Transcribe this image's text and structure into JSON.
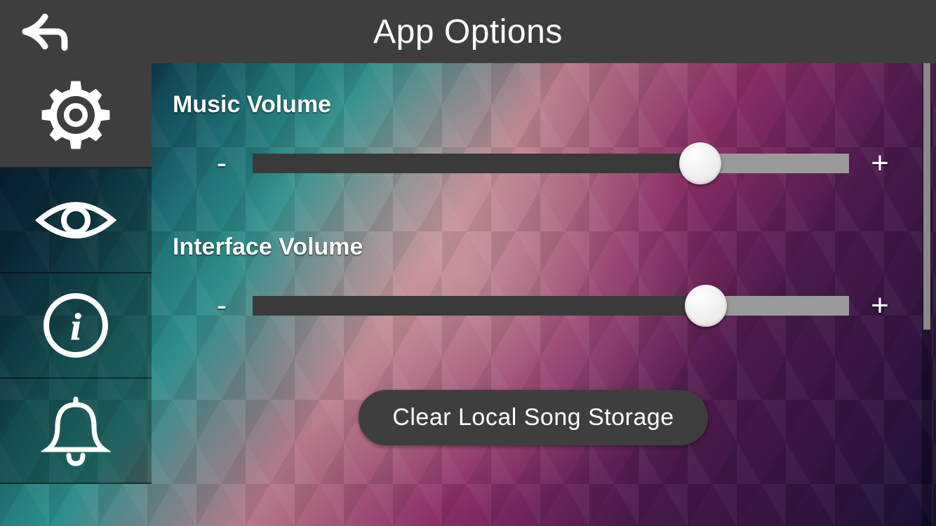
{
  "header": {
    "title": "App Options"
  },
  "sidebar": {
    "active_index": 0,
    "items": [
      {
        "icon": "gear-icon"
      },
      {
        "icon": "eye-icon"
      },
      {
        "icon": "info-icon"
      },
      {
        "icon": "bell-icon"
      }
    ]
  },
  "settings": {
    "music_volume": {
      "label": "Music Volume",
      "minus": "-",
      "plus": "+",
      "value_percent": 75
    },
    "interface_volume": {
      "label": "Interface Volume",
      "minus": "-",
      "plus": "+",
      "value_percent": 76
    },
    "clear_button_label": "Clear Local Song Storage"
  }
}
